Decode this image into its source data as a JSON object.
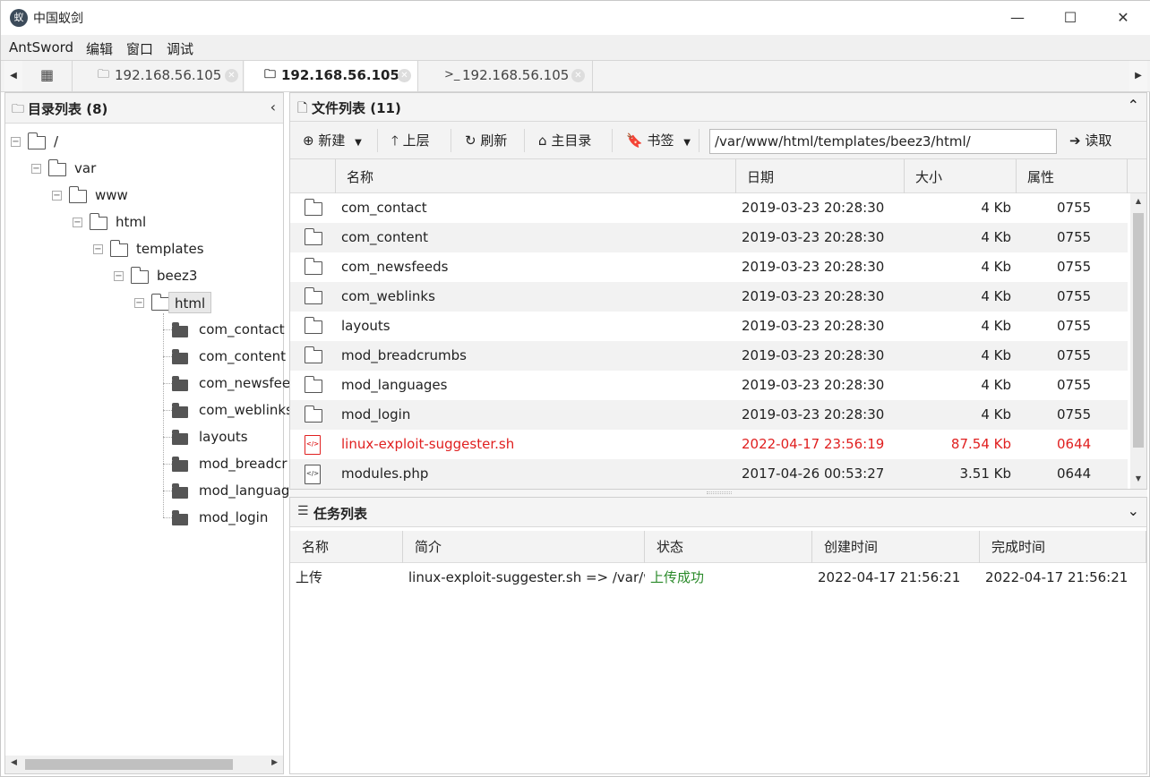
{
  "window": {
    "title": "中国蚁剑",
    "logo_text": "蚁",
    "minimize_glyph": "—",
    "maximize_glyph": "☐",
    "close_glyph": "✕"
  },
  "menu": [
    "AntSword",
    "编辑",
    "窗口",
    "调试"
  ],
  "tabs": [
    {
      "icon": "folder-icon",
      "label": "192.168.56.105",
      "active": false
    },
    {
      "icon": "folder-icon",
      "label": "192.168.56.105",
      "active": true
    },
    {
      "icon": "terminal-icon",
      "label": "192.168.56.105",
      "active": false
    }
  ],
  "tab_glyphs": {
    "folder": "🗀",
    "terminal": ">_",
    "close": "✕",
    "home": "▦",
    "scroll_left": "◀",
    "scroll_right": "▶"
  },
  "left_panel": {
    "title": "目录列表 (8)",
    "tree": [
      {
        "label": "/",
        "depth": 0,
        "type": "open"
      },
      {
        "label": "var",
        "depth": 1,
        "type": "open"
      },
      {
        "label": "www",
        "depth": 2,
        "type": "open"
      },
      {
        "label": "html",
        "depth": 3,
        "type": "open"
      },
      {
        "label": "templates",
        "depth": 4,
        "type": "open"
      },
      {
        "label": "beez3",
        "depth": 5,
        "type": "open"
      },
      {
        "label": "html",
        "depth": 6,
        "type": "open",
        "selected": true
      },
      {
        "label": "com_contact",
        "depth": 7,
        "type": "leaf"
      },
      {
        "label": "com_content",
        "depth": 7,
        "type": "leaf"
      },
      {
        "label": "com_newsfee",
        "depth": 7,
        "type": "leaf"
      },
      {
        "label": "com_weblinks",
        "depth": 7,
        "type": "leaf"
      },
      {
        "label": "layouts",
        "depth": 7,
        "type": "leaf"
      },
      {
        "label": "mod_breadcr",
        "depth": 7,
        "type": "leaf"
      },
      {
        "label": "mod_languag",
        "depth": 7,
        "type": "leaf"
      },
      {
        "label": "mod_login",
        "depth": 7,
        "type": "leaf"
      }
    ]
  },
  "file_panel": {
    "title": "文件列表 (11)",
    "toolbar": {
      "new": "新建",
      "up": "上层",
      "refresh": "刷新",
      "home": "主目录",
      "bookmark": "书签",
      "read": "读取",
      "path": "/var/www/html/templates/beez3/html/"
    },
    "columns": [
      "名称",
      "日期",
      "大小",
      "属性"
    ],
    "rows": [
      {
        "name": "com_contact",
        "date": "2019-03-23 20:28:30",
        "size": "4 Kb",
        "perm": "0755",
        "kind": "folder"
      },
      {
        "name": "com_content",
        "date": "2019-03-23 20:28:30",
        "size": "4 Kb",
        "perm": "0755",
        "kind": "folder"
      },
      {
        "name": "com_newsfeeds",
        "date": "2019-03-23 20:28:30",
        "size": "4 Kb",
        "perm": "0755",
        "kind": "folder"
      },
      {
        "name": "com_weblinks",
        "date": "2019-03-23 20:28:30",
        "size": "4 Kb",
        "perm": "0755",
        "kind": "folder"
      },
      {
        "name": "layouts",
        "date": "2019-03-23 20:28:30",
        "size": "4 Kb",
        "perm": "0755",
        "kind": "folder"
      },
      {
        "name": "mod_breadcrumbs",
        "date": "2019-03-23 20:28:30",
        "size": "4 Kb",
        "perm": "0755",
        "kind": "folder"
      },
      {
        "name": "mod_languages",
        "date": "2019-03-23 20:28:30",
        "size": "4 Kb",
        "perm": "0755",
        "kind": "folder"
      },
      {
        "name": "mod_login",
        "date": "2019-03-23 20:28:30",
        "size": "4 Kb",
        "perm": "0755",
        "kind": "folder"
      },
      {
        "name": "linux-exploit-suggester.sh",
        "date": "2022-04-17 23:56:19",
        "size": "87.54 Kb",
        "perm": "0644",
        "kind": "code",
        "highlight": true
      },
      {
        "name": "modules.php",
        "date": "2017-04-26 00:53:27",
        "size": "3.51 Kb",
        "perm": "0644",
        "kind": "code"
      }
    ]
  },
  "task_panel": {
    "title": "任务列表",
    "columns": [
      "名称",
      "简介",
      "状态",
      "创建时间",
      "完成时间"
    ],
    "rows": [
      {
        "name": "上传",
        "desc": "linux-exploit-suggester.sh => /var/w",
        "status": "上传成功",
        "created": "2022-04-17 21:56:21",
        "finished": "2022-04-17 21:56:21"
      }
    ]
  },
  "colors": {
    "highlight": "#e02020",
    "success": "#2a8a2a"
  }
}
